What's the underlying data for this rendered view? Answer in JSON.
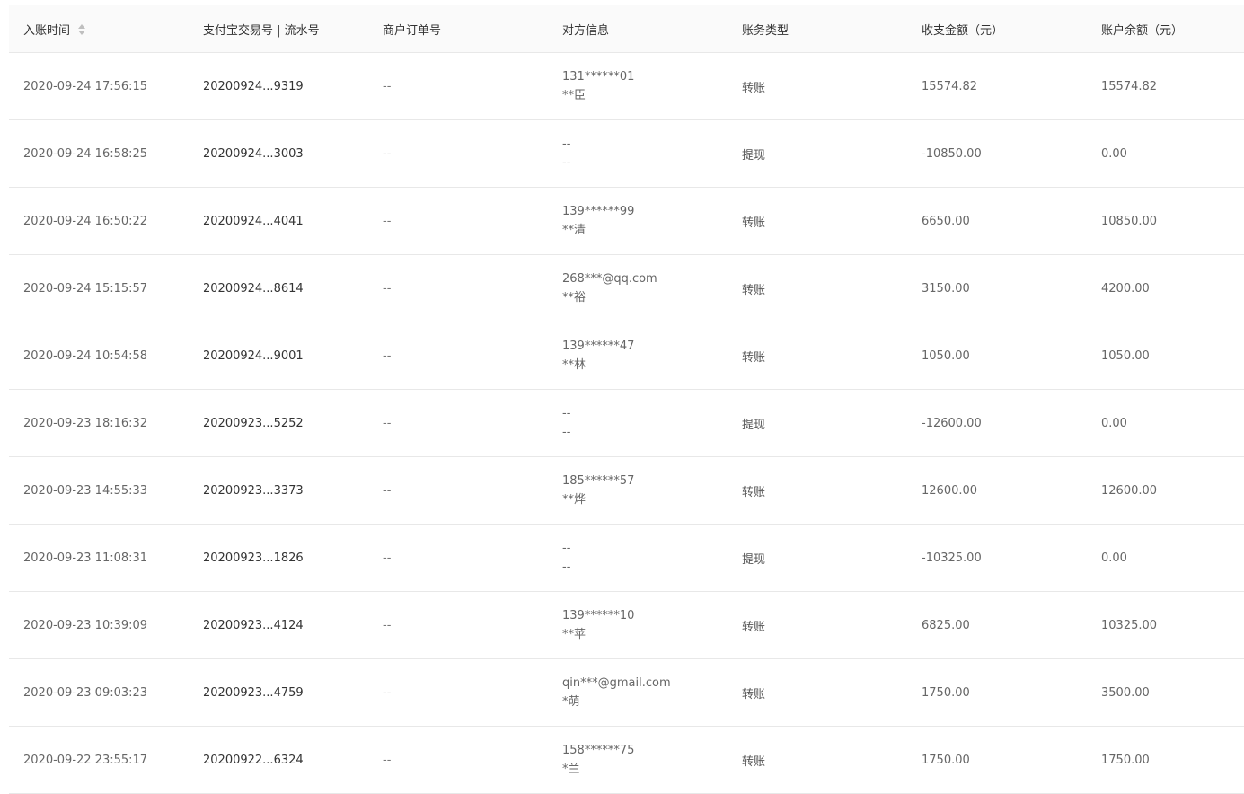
{
  "header": {
    "columns": [
      {
        "label": "入账时间",
        "sortable": true
      },
      {
        "label": "支付宝交易号 | 流水号"
      },
      {
        "label": "商户订单号"
      },
      {
        "label": "对方信息"
      },
      {
        "label": "账务类型"
      },
      {
        "label": "收支金额（元）"
      },
      {
        "label": "账户余额（元）"
      }
    ]
  },
  "rows": [
    {
      "time": "2020-09-24 17:56:15",
      "trade_no": "20200924...9319",
      "order_no": "--",
      "party_account": "131******01",
      "party_name": "**臣",
      "type": "转账",
      "amount": "15574.82",
      "balance": "15574.82"
    },
    {
      "time": "2020-09-24 16:58:25",
      "trade_no": "20200924...3003",
      "order_no": "--",
      "party_account": "--",
      "party_name": "--",
      "type": "提现",
      "amount": "-10850.00",
      "balance": "0.00"
    },
    {
      "time": "2020-09-24 16:50:22",
      "trade_no": "20200924...4041",
      "order_no": "--",
      "party_account": "139******99",
      "party_name": "**清",
      "type": "转账",
      "amount": "6650.00",
      "balance": "10850.00"
    },
    {
      "time": "2020-09-24 15:15:57",
      "trade_no": "20200924...8614",
      "order_no": "--",
      "party_account": "268***@qq.com",
      "party_name": "**裕",
      "type": "转账",
      "amount": "3150.00",
      "balance": "4200.00"
    },
    {
      "time": "2020-09-24 10:54:58",
      "trade_no": "20200924...9001",
      "order_no": "--",
      "party_account": "139******47",
      "party_name": "**林",
      "type": "转账",
      "amount": "1050.00",
      "balance": "1050.00"
    },
    {
      "time": "2020-09-23 18:16:32",
      "trade_no": "20200923...5252",
      "order_no": "--",
      "party_account": "--",
      "party_name": "--",
      "type": "提现",
      "amount": "-12600.00",
      "balance": "0.00"
    },
    {
      "time": "2020-09-23 14:55:33",
      "trade_no": "20200923...3373",
      "order_no": "--",
      "party_account": "185******57",
      "party_name": "**烨",
      "type": "转账",
      "amount": "12600.00",
      "balance": "12600.00"
    },
    {
      "time": "2020-09-23 11:08:31",
      "trade_no": "20200923...1826",
      "order_no": "--",
      "party_account": "--",
      "party_name": "--",
      "type": "提现",
      "amount": "-10325.00",
      "balance": "0.00"
    },
    {
      "time": "2020-09-23 10:39:09",
      "trade_no": "20200923...4124",
      "order_no": "--",
      "party_account": "139******10",
      "party_name": "**苹",
      "type": "转账",
      "amount": "6825.00",
      "balance": "10325.00"
    },
    {
      "time": "2020-09-23 09:03:23",
      "trade_no": "20200923...4759",
      "order_no": "--",
      "party_account": "qin***@gmail.com",
      "party_name": "*萌",
      "type": "转账",
      "amount": "1750.00",
      "balance": "3500.00"
    },
    {
      "time": "2020-09-22 23:55:17",
      "trade_no": "20200922...6324",
      "order_no": "--",
      "party_account": "158******75",
      "party_name": "*兰",
      "type": "转账",
      "amount": "1750.00",
      "balance": "1750.00"
    }
  ],
  "icons": {
    "sort": "sort-icon"
  },
  "colors": {
    "header_bg": "#fafafa",
    "border": "#e8e8e8",
    "text": "#555555",
    "sort_icon": "#bfbfbf"
  }
}
